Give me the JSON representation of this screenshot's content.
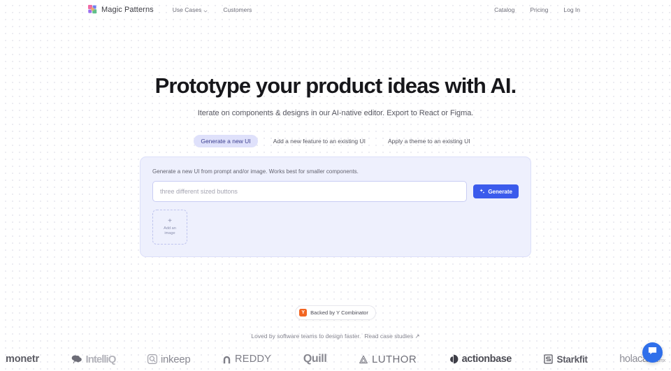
{
  "brand": {
    "name": "Magic Patterns",
    "logo_icon": "magic-patterns-pinwheel-logo",
    "colors": [
      "#f06aa5",
      "#6f7ff0",
      "#9b6ef0",
      "#5fc08a",
      "#f0a85f"
    ]
  },
  "nav": {
    "left_links": [
      {
        "label": "Use Cases",
        "has_dropdown": true,
        "icon": "chevron-down-icon"
      },
      {
        "label": "Customers",
        "has_dropdown": false
      }
    ],
    "right_links": [
      {
        "label": "Catalog"
      },
      {
        "label": "Pricing"
      },
      {
        "label": "Log In"
      }
    ]
  },
  "hero": {
    "title": "Prototype your product ideas with AI.",
    "subtitle": "Iterate on components & designs in our AI-native editor. Export to React or Figma."
  },
  "tabs": {
    "active_index": 0,
    "items": [
      {
        "label": "Generate a new UI",
        "active": true
      },
      {
        "label": "Add a new feature to an existing UI",
        "active": false
      },
      {
        "label": "Apply a theme to an existing UI",
        "active": false
      }
    ],
    "active_bg": "#dfe1fb",
    "active_fg": "#3c3f8f"
  },
  "generator": {
    "hint": "Generate a new UI from prompt and/or image. Works best for smaller components.",
    "prompt_value": "",
    "prompt_placeholder": "three different sized buttons",
    "generate_label": "Generate",
    "generate_icon": "sparkle-icon",
    "generate_color": "#3b5bec",
    "dropzone": {
      "plus_icon": "plus-icon",
      "label_line1": "Add an",
      "label_line2": "image"
    },
    "card_bg": "#eef0fd",
    "card_border": "#dcdffa"
  },
  "yc_badge": {
    "mark": "Y",
    "mark_color": "#f26522",
    "text": "Backed by Y Combinator"
  },
  "loved": {
    "text": "Loved by software teams to design faster.",
    "link_label": "Read case studies",
    "link_icon": "arrow-up-right-icon"
  },
  "logos": [
    {
      "name": "monetr",
      "icon": null,
      "class": "lg-monetr"
    },
    {
      "name": "IntelliQ",
      "icon": "brain-icon",
      "class": "lg-intelliq"
    },
    {
      "name": "inkeep",
      "icon": "magnifier-square-icon",
      "class": "lg-inkeep"
    },
    {
      "name": "REDDY",
      "icon": "arch-icon",
      "class": "lg-reddy"
    },
    {
      "name": "Quill",
      "icon": null,
      "class": "lg-quill"
    },
    {
      "name": "LUTHOR",
      "icon": "triangle-outline-icon",
      "class": "lg-luthor"
    },
    {
      "name": "actionbase",
      "icon": "half-moon-icon",
      "class": "lg-action"
    },
    {
      "name": "Starkfit",
      "icon": "s-block-icon",
      "class": "lg-stark"
    },
    {
      "name": "holacasa",
      "icon": null,
      "class": "lg-hola",
      "suffix": ".mx"
    }
  ],
  "chat": {
    "icon": "chat-bubble-icon",
    "color": "#2f6fea"
  }
}
